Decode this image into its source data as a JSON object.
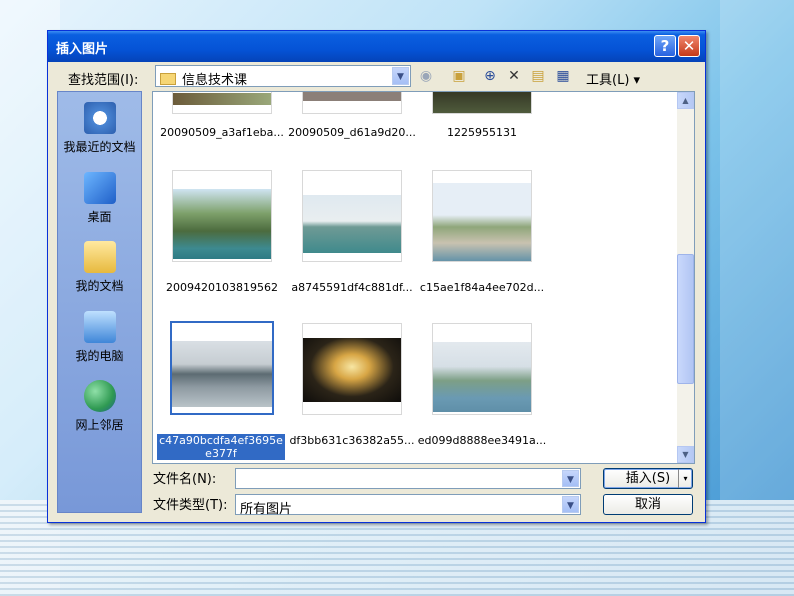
{
  "dialog": {
    "title": "插入图片",
    "help_glyph": "?",
    "close_glyph": "✕"
  },
  "lookin": {
    "label": "查找范围(I):",
    "value": "信息技术课"
  },
  "toolbar": {
    "tools_label": "工具(L)",
    "icons": [
      "back-icon",
      "up-folder-icon",
      "search-web-icon",
      "delete-icon",
      "new-folder-icon",
      "views-icon"
    ]
  },
  "places": [
    {
      "label": "我最近的文档",
      "icon": "recent-documents-icon",
      "color": "#4a86d4"
    },
    {
      "label": "桌面",
      "icon": "desktop-icon",
      "color": "#3b7bd0"
    },
    {
      "label": "我的文档",
      "icon": "my-documents-icon",
      "color": "#f2cf5a"
    },
    {
      "label": "我的电脑",
      "icon": "my-computer-icon",
      "color": "#4aa0e0"
    },
    {
      "label": "网上邻居",
      "icon": "network-places-icon",
      "color": "#2f9a52"
    }
  ],
  "files": [
    {
      "name": "20090509_a3af1eba...",
      "selected": false
    },
    {
      "name": "20090509_d61a9d20...",
      "selected": false
    },
    {
      "name": "1225955131",
      "selected": false
    },
    {
      "name": "2009420103819562",
      "selected": false
    },
    {
      "name": "a8745591df4c881df...",
      "selected": false
    },
    {
      "name": "c15ae1f84a4ee702d...",
      "selected": false
    },
    {
      "name": "c47a90bcdfa4ef3695ee377f",
      "selected": true
    },
    {
      "name": "df3bb631c36382a55...",
      "selected": false
    },
    {
      "name": "ed099d8888ee3491a...",
      "selected": false
    }
  ],
  "filename": {
    "label": "文件名(N):",
    "value": ""
  },
  "filetype": {
    "label": "文件类型(T):",
    "value": "所有图片"
  },
  "buttons": {
    "insert": "插入(S)",
    "cancel": "取消"
  }
}
